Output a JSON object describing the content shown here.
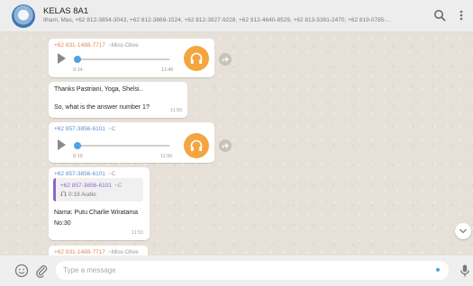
{
  "header": {
    "title": "KELAS 8A1",
    "subtitle": "Ilham, Mas, +62 812-3854-3043, +62 812-3869-1524, +62 812-3927-9228, +62 812-4640-8529, +62 813-5391-2470, +62 819-0785-..."
  },
  "messages": [
    {
      "type": "audio",
      "sender_number": "+62 831-1488-7717",
      "sender_name": "~Miss Olive",
      "elapsed": "0:14",
      "time": "11:46"
    },
    {
      "type": "text",
      "line1": "Thanks Pastriani, Yoga, Shelsi..",
      "line2": "So, what is the answer number 1?",
      "time": "11:50"
    },
    {
      "type": "audio",
      "sender_number": "+62 857-3856-6101",
      "sender_name": "~C",
      "elapsed": "0:19",
      "time": "11:50"
    },
    {
      "type": "reply",
      "sender_number": "+62 857-3856-6101",
      "sender_name": "~C",
      "quote_number": "+62 857-3856-6101",
      "quote_name": "~C",
      "quote_audio": "0:19 Audio",
      "line1": "Nama: Putu Charlie Wiratama",
      "line2": "No:30",
      "time": "11:51"
    },
    {
      "type": "partial",
      "sender_number": "+62 831-1488-7717",
      "sender_name": "~Miss Olive"
    }
  ],
  "composer": {
    "placeholder": "Type a message"
  },
  "colors": {
    "accent_orange": "#f4a540",
    "audio_blue": "#4fa3e6",
    "quote_purple": "#8c67c8"
  }
}
